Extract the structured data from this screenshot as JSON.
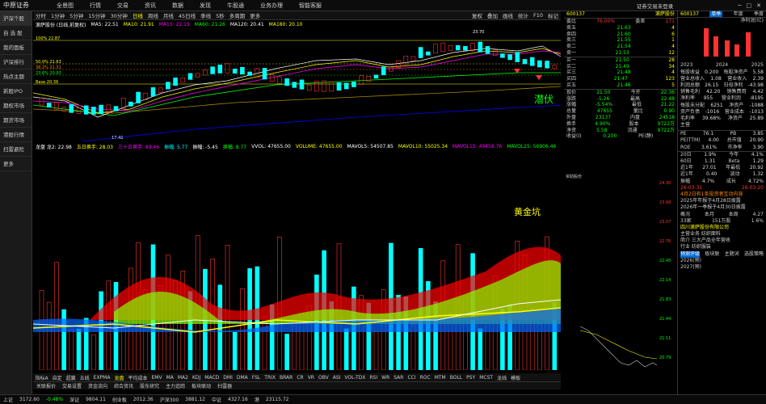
{
  "app": {
    "logo": "中原证券",
    "menu": [
      "全景图",
      "行情",
      "交易",
      "资讯",
      "数据",
      "发现",
      "牛股通",
      "业务办理",
      "智能客服"
    ],
    "login": "证券交易未登录"
  },
  "sidebar": [
    "沪深个股",
    "自 选 股",
    "我的面板",
    "沪深排行",
    "热点主题",
    "新股IPO",
    "期权市场",
    "期货市场",
    "港股行情",
    "扫雷避险",
    "更多"
  ],
  "toolbar": {
    "left": [
      "分时",
      "1分钟",
      "5分钟",
      "15分钟",
      "30分钟",
      "日线",
      "周线",
      "月线",
      "45日线",
      "季线",
      "5秒",
      "多周期",
      "更多"
    ],
    "active": "日线",
    "right": [
      "复权",
      "叠加",
      "画线",
      "统计",
      "F10",
      "标记"
    ]
  },
  "ma_line": {
    "title": "滚萨股份 (日线,前复权)",
    "items": [
      {
        "t": "MA5: 22.51",
        "c": "#fff"
      },
      {
        "t": "MA10: 21.91",
        "c": "#ff0"
      },
      {
        "t": "MA15: 22.19",
        "c": "#f0f"
      },
      {
        "t": "MA60: 21.26",
        "c": "#0f0"
      },
      {
        "t": "MA120: 20.41",
        "c": "#fff"
      },
      {
        "t": "MA180: 20.10",
        "c": "#ff0"
      }
    ]
  },
  "price_labels": {
    "max": "23.70",
    "min": "17.46",
    "l1": "100% 22.87",
    "l2": "50.0% 21.63",
    "l3": "38.2% 21.31",
    "l4": "23.6% 20.93",
    "l5": "Base 20.39",
    "qianfu": "潜伏"
  },
  "vol_line": {
    "items": [
      {
        "t": "龙盘 龙2: 22.98",
        "c": "#fff"
      },
      {
        "t": "五日换手: 28.03",
        "c": "#ff0"
      },
      {
        "t": "三十日换手: 89.46",
        "c": "#f0f"
      },
      {
        "t": "振幅: 5.77",
        "c": "#0ff"
      },
      {
        "t": "振幅: -5.45",
        "c": "#fff"
      },
      {
        "t": "换幅: 8.77",
        "c": "#0f0"
      },
      {
        "t": "VVOL: 47655.00",
        "c": "#fff"
      },
      {
        "t": "VOLUME: 47655.00",
        "c": "#ff0"
      },
      {
        "t": "MAVOL5: 54507.85",
        "c": "#fff"
      },
      {
        "t": "MAVOL10: 55025.34",
        "c": "#ff0"
      },
      {
        "t": "MAVOL15: 49458.76",
        "c": "#f0f"
      },
      {
        "t": "MAVOL25: 56906.46",
        "c": "#0f0"
      }
    ]
  },
  "ind_line": {
    "label": "黄金坑"
  },
  "ind_tabs": [
    "指标A",
    "自定",
    "超赢",
    "五线",
    "EXPMA",
    "龙盘",
    "平均成本",
    "EMV",
    "MA",
    "MA2",
    "KDJ",
    "MACD",
    "DMI",
    "DMA",
    "FSL",
    "TRIX",
    "BRAR",
    "CR",
    "VR",
    "OBV",
    "ASI",
    "VOL-TDX",
    "RSI",
    "WR",
    "SAR",
    "CCI",
    "ROC",
    "MTM",
    "BOLL",
    "PSY",
    "MCST",
    "龙线",
    "模板"
  ],
  "bottom_tabs": [
    "关联报价",
    "交易设置",
    "资金流向",
    "综合资讯",
    "股东研究",
    "主力追踪",
    "板块联动",
    "扫雷器"
  ],
  "quote": {
    "code": "600137",
    "name": "滚萨股份",
    "weibi": "76.00%",
    "weicha": "171",
    "asks": [
      [
        "卖五",
        "21.63",
        "4"
      ],
      [
        "卖四",
        "21.60",
        "6"
      ],
      [
        "卖三",
        "21.55",
        "1"
      ],
      [
        "卖二",
        "21.54",
        "4"
      ],
      [
        "卖一",
        "21.53",
        "12"
      ]
    ],
    "bids": [
      [
        "买一",
        "21.50",
        "28"
      ],
      [
        "买二",
        "21.49",
        "34"
      ],
      [
        "买三",
        "21.48",
        "4"
      ],
      [
        "买四",
        "21.47",
        "123"
      ],
      [
        "买五",
        "21.46",
        "5"
      ]
    ],
    "stats": [
      [
        "现价",
        "21.50",
        "今开",
        "22.36"
      ],
      [
        "涨跌",
        "-1.26",
        "最高",
        "22.48"
      ],
      [
        "涨幅",
        "-5.54%",
        "最低",
        "21.22"
      ],
      [
        "总量",
        "47655",
        "量比",
        "0.90"
      ],
      [
        "外盘",
        "23137",
        "内盘",
        "24518"
      ],
      [
        "换手",
        "4.90%",
        "股本",
        "9722万"
      ],
      [
        "净资",
        "5.58",
        "流通",
        "9722万"
      ],
      [
        "收益(I)",
        "0.200",
        "PE(静)",
        ""
      ]
    ]
  },
  "right": {
    "code": "600137",
    "title": "单季",
    "tab2": "年度",
    "tab3": "季度",
    "header": "净利润(亿)",
    "years": [
      "2023",
      "2024",
      "2025"
    ],
    "rows": [
      [
        "每股收益",
        "0.200",
        "每股净资产",
        "5.58"
      ],
      [
        "营业总收入",
        "1.08",
        "营业收入",
        "2.39"
      ],
      [
        "利润总额",
        "26.15",
        "归母净利",
        "-43.98"
      ],
      [
        "销售毛利",
        "42.20",
        "销售费用",
        "4.42"
      ],
      [
        "净利率",
        "955",
        "营业利润",
        "-8195"
      ],
      [
        "每股未分配",
        "6251",
        "净资产",
        "-1088"
      ],
      [
        "资产负债",
        "-1016",
        "营业成本",
        "-1013"
      ],
      [
        "毛利率",
        "39.68%",
        "净资产",
        "25.89"
      ],
      [
        "主营",
        "",
        ""
      ]
    ],
    "val": [
      [
        "PE",
        "76.1",
        "PB",
        "3.85"
      ],
      [
        "PE(TTM)",
        "4.00",
        "总市值",
        "20.90"
      ],
      [
        "ROE",
        "3.61%",
        "市净率",
        "3.90"
      ]
    ],
    "perf": [
      [
        "20日",
        "1.9%",
        "今年",
        "4.1%"
      ],
      [
        "60日",
        "1.31",
        "Beta",
        "1.29"
      ],
      [
        "近1年",
        "27.01",
        "年最低",
        "20.92"
      ],
      [
        "近1年",
        "0.40",
        "波动",
        "1.32"
      ],
      [
        "振幅",
        "4.7%",
        "成长",
        "4.72%"
      ]
    ],
    "dates": [
      "26-03-31",
      "26-03-20"
    ],
    "notes": [
      "4月2日有1条投资者互动内容",
      "2025年年报于4月28日披露",
      "2026年一季报于4月30日披露"
    ],
    "rank": [
      "概况",
      "本月",
      "本周",
      "4.27"
    ],
    "holders": [
      "33家",
      "151万股",
      "1.6%"
    ],
    "co": "四川滚萨股份有限公司",
    "desc": [
      "主营业务 纺织面料",
      "简介 三大产品全年营收",
      "行业 纺织服装"
    ],
    "ratings": [
      "预测评级",
      "板块联",
      "主题词",
      "选股策略"
    ],
    "forecast": [
      "2026(预)",
      "2027(预)"
    ]
  },
  "minichart": {
    "labels": [
      "24.30",
      "23.68",
      "23.07",
      "22.76",
      "22.45",
      "22.14",
      "21.83",
      "21.44",
      "21.11",
      "20.79"
    ],
    "title": "资助股份"
  },
  "status": [
    "上证",
    "3172.60",
    "-0.48%",
    "深证",
    "9804.11",
    "创业板",
    "2012.36",
    "沪深300",
    "3881.12",
    "中证",
    "4327.16",
    "港",
    "23115.72"
  ]
}
